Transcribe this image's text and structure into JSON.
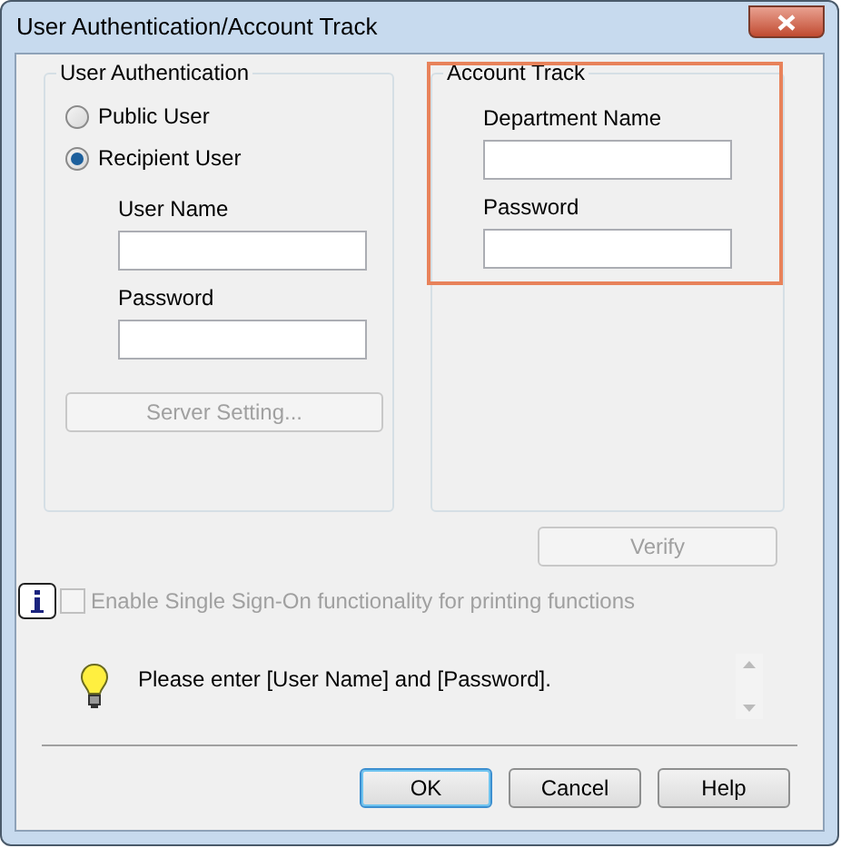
{
  "window": {
    "title": "User Authentication/Account Track"
  },
  "user_authentication": {
    "title": "User Authentication",
    "options": [
      {
        "label": "Public User",
        "selected": false
      },
      {
        "label": "Recipient User",
        "selected": true
      }
    ],
    "fields": [
      {
        "label": "User Name"
      },
      {
        "label": "Password"
      }
    ],
    "server_button": {
      "label": "Server Setting...",
      "disabled": true
    }
  },
  "account_track": {
    "title": "Account Track",
    "highlighted": true,
    "fields": [
      {
        "label": "Department Name"
      },
      {
        "label": "Password"
      }
    ]
  },
  "verify_button": {
    "label": "Verify",
    "disabled": true
  },
  "single_sign_on": {
    "label": "Enable Single Sign-On functionality for printing functions",
    "checked": false,
    "disabled": true
  },
  "message": "Please enter [User Name] and [Password].",
  "buttons": [
    {
      "label": "OK",
      "default": true
    },
    {
      "label": "Cancel",
      "default": false
    },
    {
      "label": "Help",
      "default": false
    }
  ]
}
